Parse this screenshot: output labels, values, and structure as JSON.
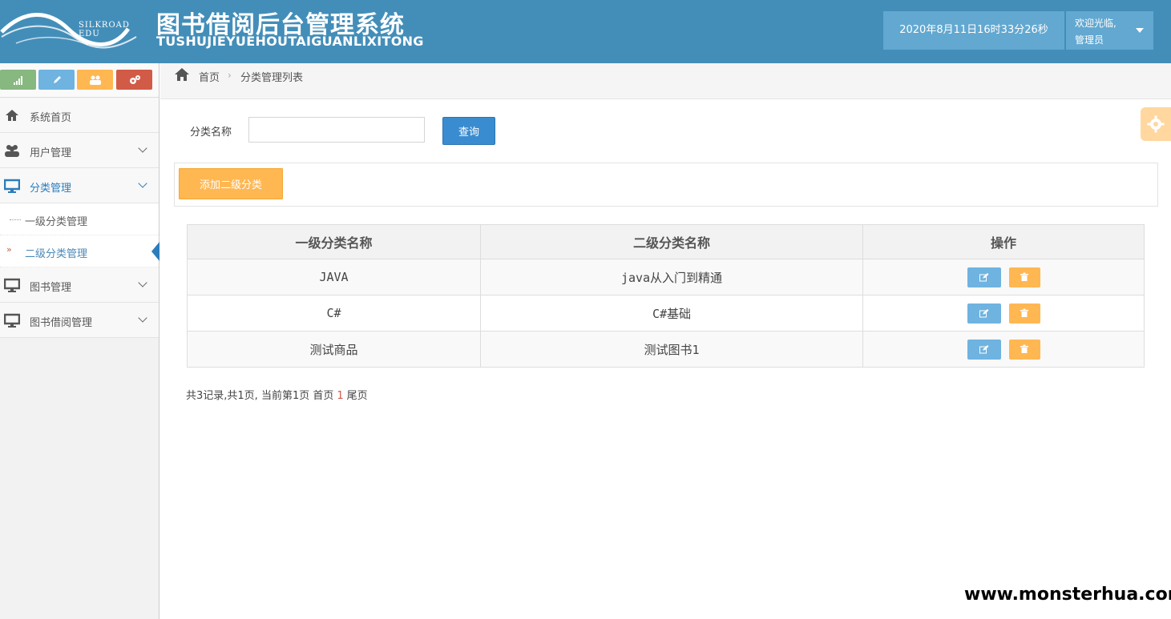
{
  "header": {
    "logo_text": "SILKROAD EDU",
    "title": "图书借阅后台管理系统",
    "subtitle": "TUSHUJIEYUEHOUTAIGUANLIXITONG",
    "datetime": "2020年8月11日16时33分26秒",
    "welcome": "欢迎光临,",
    "username": "管理员"
  },
  "sidebar": {
    "items": [
      {
        "label": "系统首页",
        "icon": "home-icon"
      },
      {
        "label": "用户管理",
        "icon": "users-icon"
      },
      {
        "label": "分类管理",
        "icon": "desktop-icon"
      },
      {
        "label": "图书管理",
        "icon": "desktop-icon"
      },
      {
        "label": "图书借阅管理",
        "icon": "desktop-icon"
      }
    ],
    "sub_items": [
      {
        "label": "一级分类管理"
      },
      {
        "label": "二级分类管理"
      }
    ]
  },
  "breadcrumb": {
    "home": "首页",
    "current": "分类管理列表"
  },
  "search": {
    "label": "分类名称",
    "value": "",
    "button": "查询"
  },
  "toolbar": {
    "add_label": "添加二级分类"
  },
  "table": {
    "headers": [
      "一级分类名称",
      "二级分类名称",
      "操作"
    ],
    "rows": [
      [
        "JAVA",
        "java从入门到精通"
      ],
      [
        "C#",
        "C#基础"
      ],
      [
        "测试商品",
        "测试图书1"
      ]
    ]
  },
  "pager": {
    "summary": "共3记录,共1页, 当前第1页 首页",
    "current": "1",
    "last": "尾页"
  },
  "watermark": "www.monsterhua.com",
  "colors": {
    "header": "#438eb9",
    "accent": "#2b7dbc",
    "warning": "#ffb752",
    "info": "#6fb3e0"
  }
}
